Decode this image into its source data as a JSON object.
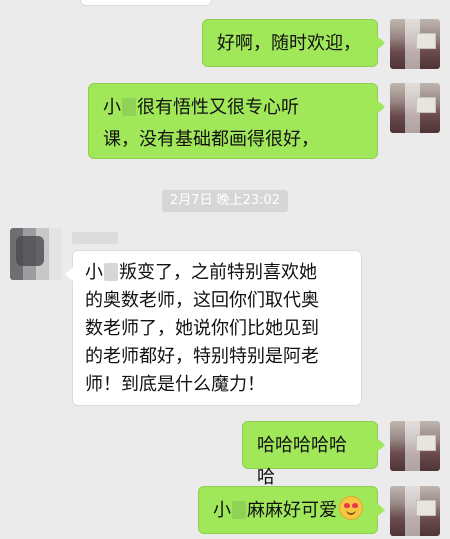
{
  "timestamp": "2月7日 晚上23:02",
  "messages": [
    {
      "id": 1,
      "side": "out",
      "text": "好啊，随时欢迎，"
    },
    {
      "id": 2,
      "side": "out",
      "line1_pre": "小",
      "line1_post": "很有悟性又很专心听",
      "line2": "课，没有基础都画得很好，"
    },
    {
      "id": 3,
      "side": "in",
      "line1_pre": "小",
      "line1_post": "叛变了，之前特别喜欢她",
      "line2": "的奥数老师，这回你们取代奥",
      "line3": "数老师了，她说你们比她见到",
      "line4": "的老师都好，特别特别是阿老",
      "line5": "师！到底是什么魔力！"
    },
    {
      "id": 4,
      "side": "out",
      "text": "哈哈哈哈哈哈"
    },
    {
      "id": 5,
      "side": "out",
      "pre": "小",
      "post": "麻麻好可爱",
      "emoji": "heart-eyes-emoji"
    }
  ]
}
